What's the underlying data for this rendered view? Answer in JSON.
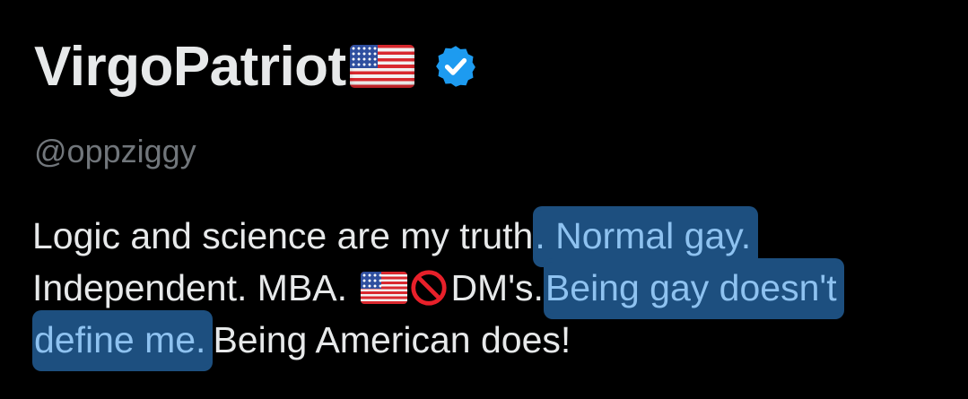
{
  "profile": {
    "display_name": "VirgoPatriot",
    "name_emoji": "us-flag-icon",
    "verified_badge": "verified-check-icon",
    "handle": "@oppziggy"
  },
  "bio": {
    "line1": {
      "plain": "Logic and science are my truth",
      "highlighted": ". Normal gay."
    },
    "line2": {
      "plain": "Independent. MBA. ",
      "emoji1": "us-flag-icon",
      "emoji2": "prohibited-icon",
      "after_emoji": "DM's. ",
      "highlighted": "Being gay doesn't"
    },
    "line3": {
      "highlighted": "define me.",
      "plain": " Being American does!"
    }
  },
  "colors": {
    "background": "#000000",
    "text": "#e7e9ea",
    "muted": "#71767b",
    "verified_blue": "#1d9bf0",
    "highlight_fill": "#1d4f7f",
    "highlight_text": "#8ec2f0"
  }
}
